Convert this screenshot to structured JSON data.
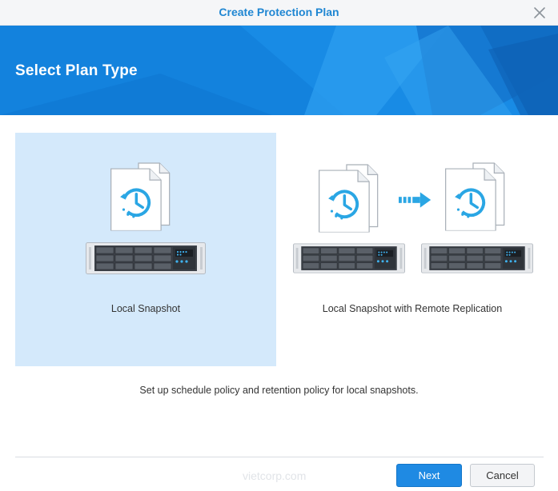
{
  "dialog": {
    "title": "Create Protection Plan"
  },
  "banner": {
    "heading": "Select Plan Type"
  },
  "options": [
    {
      "label": "Local Snapshot",
      "selected": true
    },
    {
      "label": "Local Snapshot with Remote Replication",
      "selected": false
    }
  ],
  "description": "Set up schedule policy and retention policy for local snapshots.",
  "footer": {
    "next_label": "Next",
    "cancel_label": "Cancel",
    "watermark": "vietcorp.com"
  },
  "colors": {
    "accent": "#1f86d2",
    "banner": "#1382dd",
    "selected_bg": "#d4e9fb",
    "primary_button": "#1f8ae3",
    "icon_blue": "#2aa6e4"
  }
}
